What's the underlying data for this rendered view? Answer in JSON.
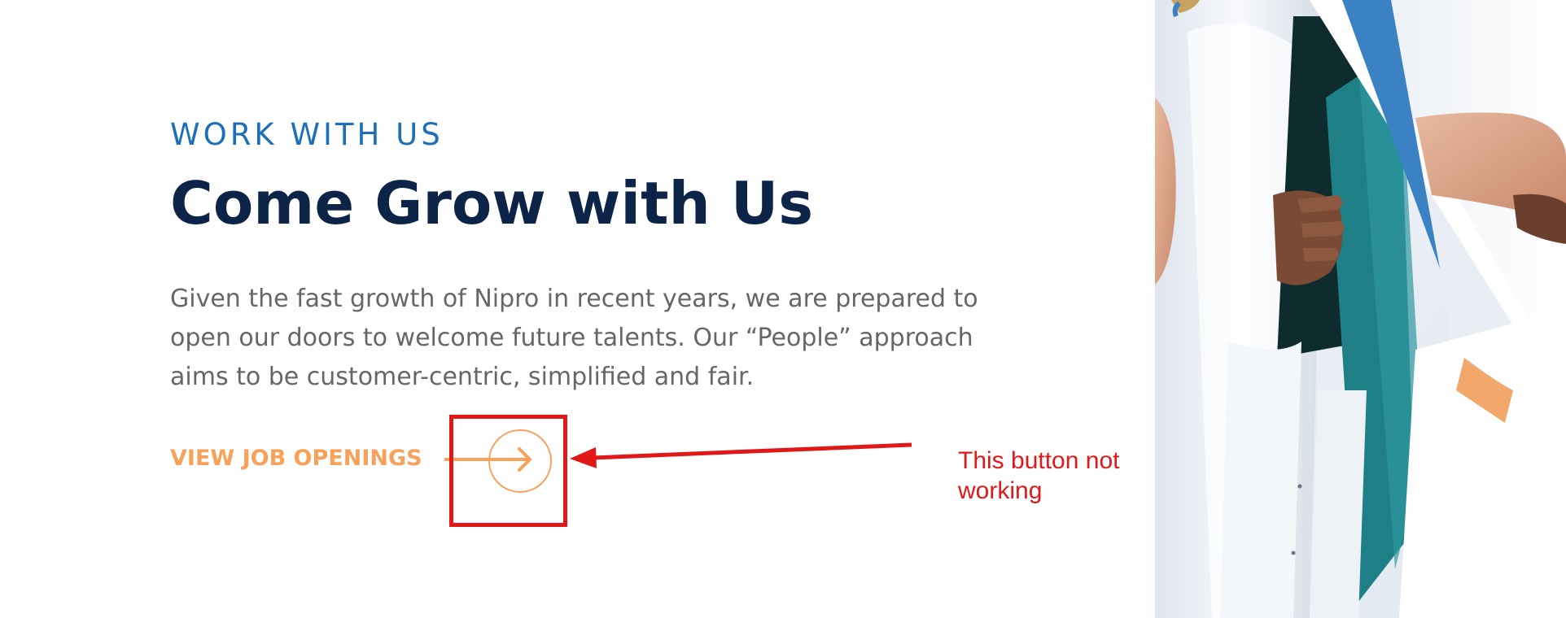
{
  "section": {
    "eyebrow": "WORK WITH US",
    "title": "Come Grow with Us",
    "description": "Given the fast growth of Nipro in recent years, we are prepared to open our doors to welcome future talents. Our “People” approach aims to be customer-centric, simplified and fair."
  },
  "cta": {
    "label": "VIEW JOB OPENINGS",
    "icon": "arrow-right-circle-icon"
  },
  "annotation": {
    "note": "This button not working",
    "color": "#e01818"
  },
  "colors": {
    "eyebrow": "#1d6fb8",
    "title": "#0b2447",
    "body_text": "#666666",
    "accent_orange": "#f7a15a"
  },
  "photo": {
    "subject": "medical-team-handshake-image"
  }
}
